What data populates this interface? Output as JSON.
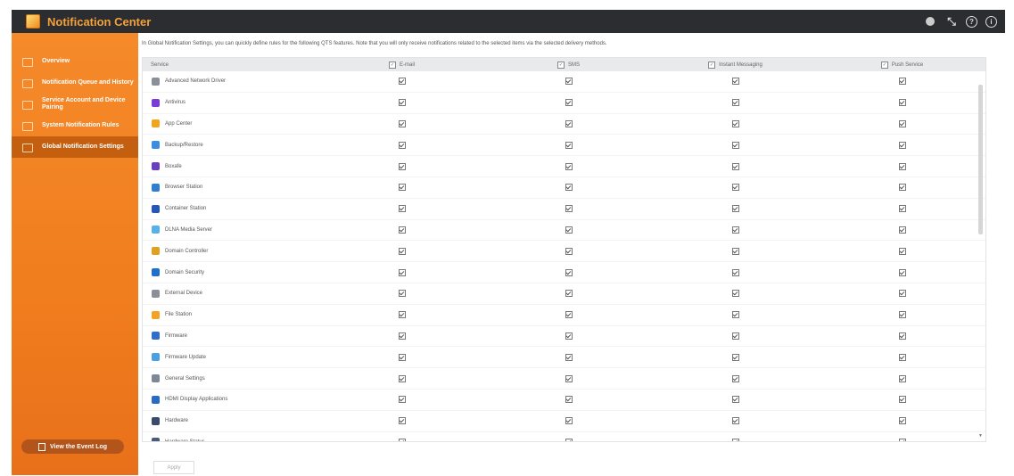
{
  "window": {
    "title": "Notification Center"
  },
  "sidebar": {
    "items": [
      {
        "label": "Overview",
        "active": false
      },
      {
        "label": "Notification Queue and History",
        "active": false
      },
      {
        "label": "Service Account and Device Pairing",
        "active": false
      },
      {
        "label": "System Notification Rules",
        "active": false
      },
      {
        "label": "Global Notification Settings",
        "active": true
      }
    ],
    "event_log_label": "View the Event Log"
  },
  "main": {
    "intro": "In Global Notification Settings, you can quickly define rules for the following QTS features. Note that you will only receive notifications related to the selected items via the selected delivery methods.",
    "columns": [
      "Service",
      "E-mail",
      "SMS",
      "Instant Messaging",
      "Push Service"
    ],
    "services": [
      {
        "name": "Advanced Network Driver",
        "color": "#8a8f98"
      },
      {
        "name": "Antivirus",
        "color": "#7a3bd6"
      },
      {
        "name": "App Center",
        "color": "#f2a41d"
      },
      {
        "name": "Backup/Restore",
        "color": "#3a8de0"
      },
      {
        "name": "Boxafe",
        "color": "#6a3fbf"
      },
      {
        "name": "Browser Station",
        "color": "#2f7fd1"
      },
      {
        "name": "Container Station",
        "color": "#2458b8"
      },
      {
        "name": "DLNA Media Server",
        "color": "#58b0e8"
      },
      {
        "name": "Domain Controller",
        "color": "#e0a020"
      },
      {
        "name": "Domain Security",
        "color": "#1f6fcf"
      },
      {
        "name": "External Device",
        "color": "#8a8f98"
      },
      {
        "name": "File Station",
        "color": "#f5a125"
      },
      {
        "name": "Firmware",
        "color": "#2f6fc6"
      },
      {
        "name": "Firmware Update",
        "color": "#4aa0e0"
      },
      {
        "name": "General Settings",
        "color": "#7d8896"
      },
      {
        "name": "HDMI Display Applications",
        "color": "#2a6cc4"
      },
      {
        "name": "Hardware",
        "color": "#3a4a6a"
      },
      {
        "name": "Hardware Status",
        "color": "#4a5a7a"
      }
    ],
    "apply_label": "Apply"
  }
}
